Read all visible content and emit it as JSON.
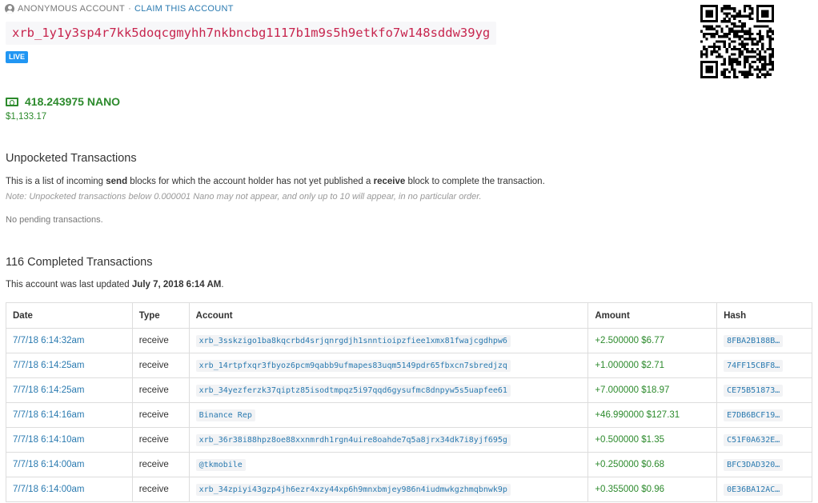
{
  "account": {
    "anon_label": "ANONYMOUS ACCOUNT",
    "separator": "·",
    "claim_label": "CLAIM THIS ACCOUNT",
    "address": "xrb_1y1y3sp4r7kk5doqcgmyhh7nkbncbg1117b1m9s5h9etkfo7w148sddw39yg",
    "live_badge": "LIVE",
    "balance": "418.243975 NANO",
    "balance_usd": "$1,133.17"
  },
  "unpocketed": {
    "title": "Unpocketed Transactions",
    "desc_1": "This is a list of incoming ",
    "desc_send": "send",
    "desc_2": " blocks for which the account holder has not yet published a ",
    "desc_receive": "receive",
    "desc_3": " block to complete the transaction.",
    "note": "Note: Unpocketed transactions below 0.000001 Nano may not appear, and only up to 10 will appear, in no particular order.",
    "empty": "No pending transactions."
  },
  "completed": {
    "title": "116 Completed Transactions",
    "updated_prefix": "This account was last updated ",
    "updated_date": "July 7, 2018 6:14 AM",
    "updated_suffix": "."
  },
  "table": {
    "headers": [
      "Date",
      "Type",
      "Account",
      "Amount",
      "Hash"
    ],
    "rows": [
      {
        "date": "7/7/18 6:14:32am",
        "type": "receive",
        "account": "xrb_3sskzigo1ba8kqcrbd4srjqnrgdjh1snntioipzfiee1xmx81fwajcgdhpw6",
        "amount": "+2.500000 $6.77",
        "hash": "8FBA2B188B…"
      },
      {
        "date": "7/7/18 6:14:25am",
        "type": "receive",
        "account": "xrb_14rtpfxqr3fbyoz6pcm9qabb9ufmapes83uqm5149pdr65fbxcn7sbredjzq",
        "amount": "+1.000000 $2.71",
        "hash": "74FF15CBF8…"
      },
      {
        "date": "7/7/18 6:14:25am",
        "type": "receive",
        "account": "xrb_34yezferzk37qiptz85isodtmpqz5i97qqd6gysufmc8dnpyw5s5uapfee61",
        "amount": "+7.000000 $18.97",
        "hash": "CE75B51873…"
      },
      {
        "date": "7/7/18 6:14:16am",
        "type": "receive",
        "account": "Binance Rep",
        "amount": "+46.990000 $127.31",
        "hash": "E7DB6BCF19…"
      },
      {
        "date": "7/7/18 6:14:10am",
        "type": "receive",
        "account": "xrb_36r38i88hpz8oe88xxnmrdh1rgn4uire8oahde7q5a8jrx34dk7i8yjf695g",
        "amount": "+0.500000 $1.35",
        "hash": "C51F0A632E…"
      },
      {
        "date": "7/7/18 6:14:00am",
        "type": "receive",
        "account": "@tkmobile",
        "amount": "+0.250000 $0.68",
        "hash": "BFC3DAD320…"
      },
      {
        "date": "7/7/18 6:14:00am",
        "type": "receive",
        "account": "xrb_34zpiyi43gzp4jh6ezr4xzy44xp6h9mnxbmjey986n4iudmwkgzhmqbnwk9p",
        "amount": "+0.355000 $0.96",
        "hash": "0E36BA12AC…"
      }
    ]
  },
  "icons": {
    "user": "user-circle-icon",
    "money": "money-bill-icon",
    "qr": "qr-code"
  },
  "colors": {
    "address_text": "#c7254e",
    "link": "#2a7ab0",
    "live_badge": "#2196f3",
    "balance_green": "#2c8a2c"
  }
}
